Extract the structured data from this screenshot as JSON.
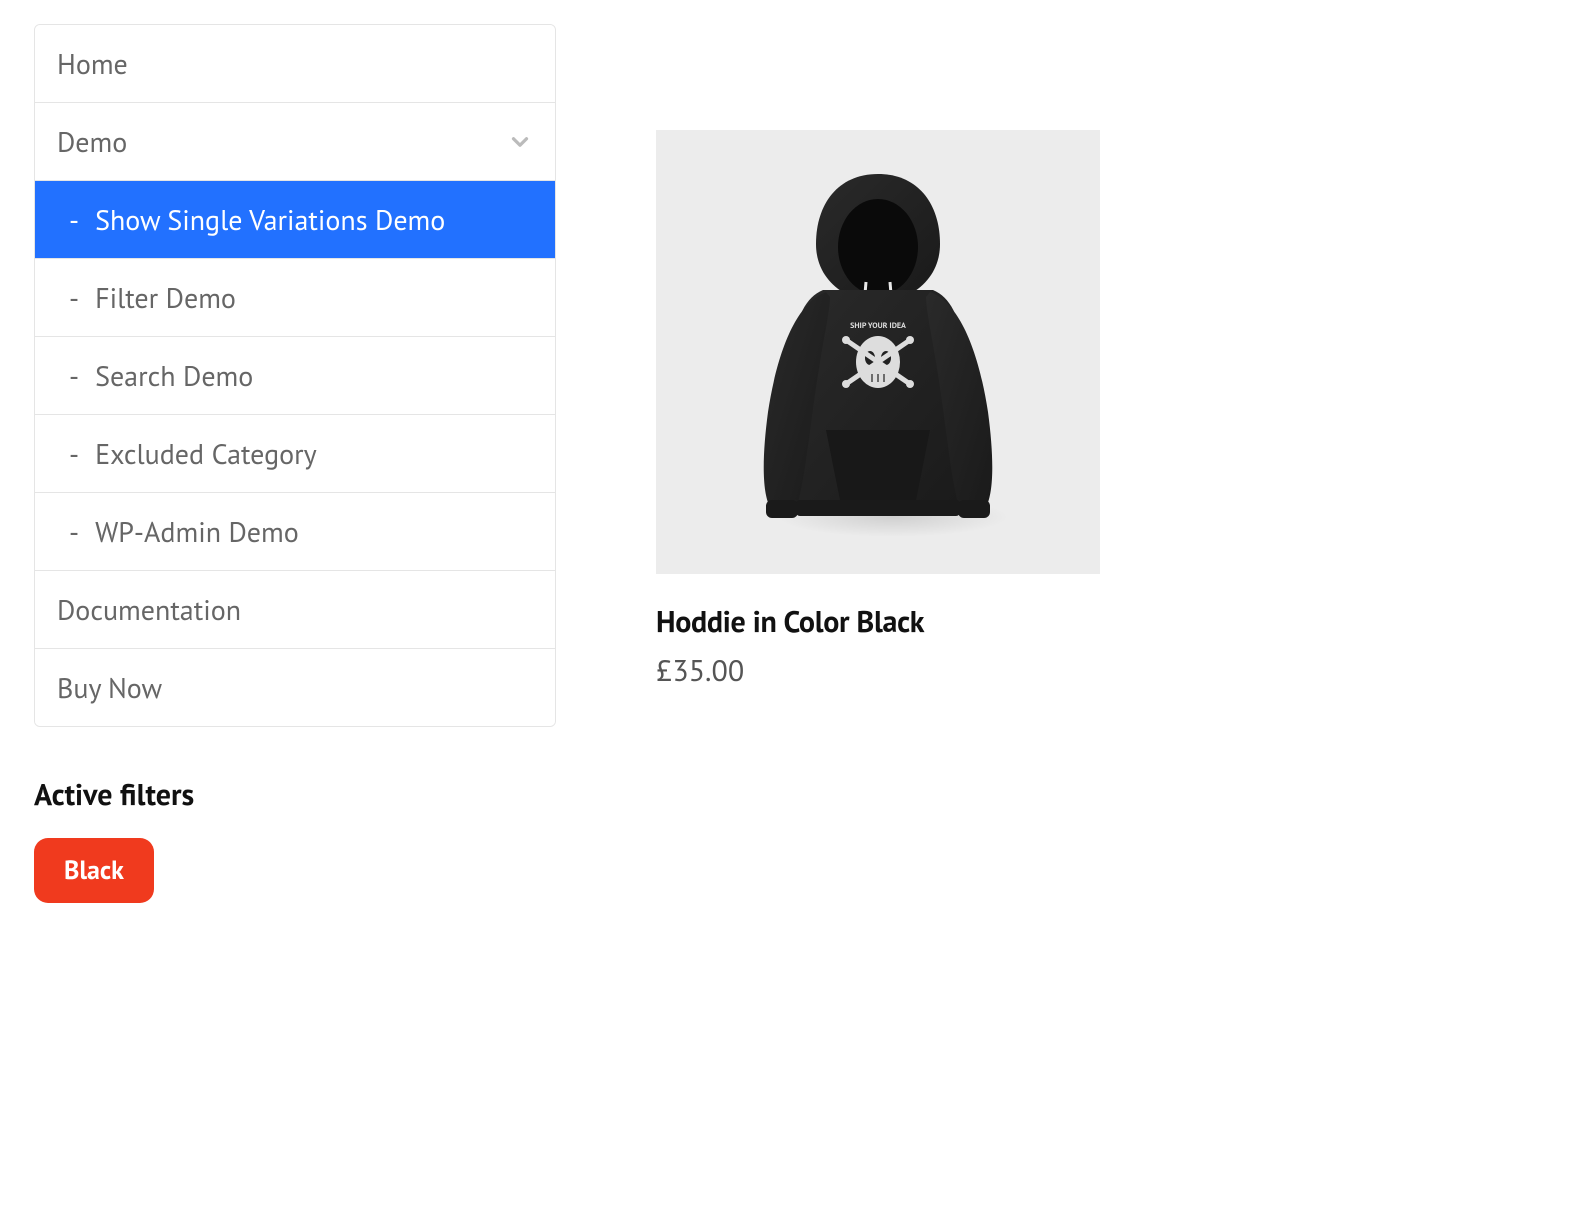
{
  "nav": {
    "home": "Home",
    "demo": "Demo",
    "sub": {
      "show_single": "Show Single Variations Demo",
      "filter": "Filter Demo",
      "search": "Search Demo",
      "excluded": "Excluded Category",
      "wpadmin": "WP-Admin Demo"
    },
    "documentation": "Documentation",
    "buy_now": "Buy Now"
  },
  "filters": {
    "heading": "Active filters",
    "chip": "Black"
  },
  "product": {
    "title": "Hoddie in Color Black",
    "price": "£35.00"
  }
}
